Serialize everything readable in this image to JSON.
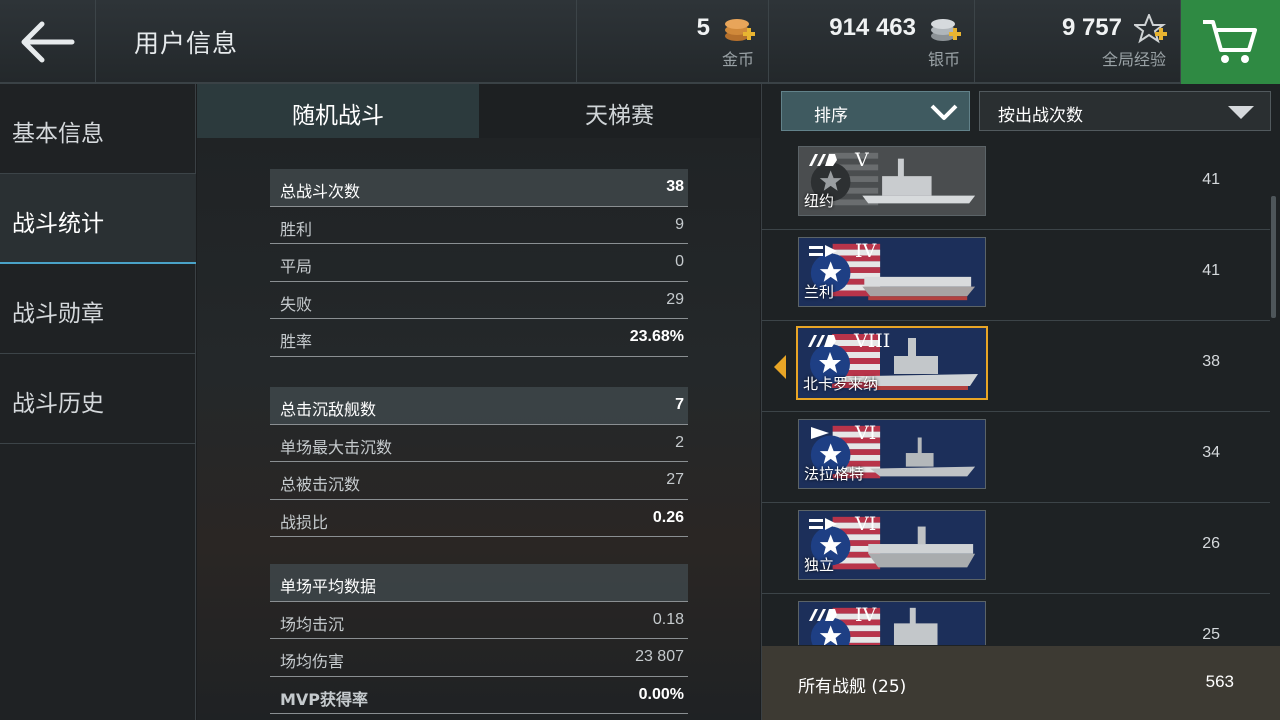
{
  "header": {
    "title": "用户信息",
    "currencies": [
      {
        "value": "5",
        "label": "金币",
        "icon": "gold-coins-icon"
      },
      {
        "value": "914 463",
        "label": "银币",
        "icon": "silver-coins-icon"
      },
      {
        "value": "9 757",
        "label": "全局经验",
        "icon": "star-xp-icon"
      }
    ]
  },
  "sidebar": {
    "items": [
      {
        "label": "基本信息",
        "active": false
      },
      {
        "label": "战斗统计",
        "active": true
      },
      {
        "label": "战斗勋章",
        "active": false
      },
      {
        "label": "战斗历史",
        "active": false
      }
    ]
  },
  "tabs": [
    {
      "label": "随机战斗",
      "active": true
    },
    {
      "label": "天梯赛",
      "active": false
    }
  ],
  "stats": {
    "group1": [
      {
        "k": "总战斗次数",
        "v": "38"
      },
      {
        "k": "胜利",
        "v": "9"
      },
      {
        "k": "平局",
        "v": "0"
      },
      {
        "k": "失败",
        "v": "29"
      },
      {
        "k": "胜率",
        "v": "23.68%"
      }
    ],
    "group2": [
      {
        "k": "总击沉敌舰数",
        "v": "7"
      },
      {
        "k": "单场最大击沉数",
        "v": "2"
      },
      {
        "k": "总被击沉数",
        "v": "27"
      },
      {
        "k": "战损比",
        "v": "0.26"
      }
    ],
    "group3": [
      {
        "k": "单场平均数据",
        "v": ""
      },
      {
        "k": "场均击沉",
        "v": "0.18"
      },
      {
        "k": "场均伤害",
        "v": "23 807"
      },
      {
        "k": "MVP获得率",
        "v": "0.00%"
      }
    ]
  },
  "sort": {
    "button_label": "排序",
    "select_value": "按出战次数"
  },
  "ships": [
    {
      "name": "纽约",
      "tier": "V",
      "count": "41"
    },
    {
      "name": "兰利",
      "tier": "IV",
      "count": "41"
    },
    {
      "name": "北卡罗来纳",
      "tier": "VIII",
      "count": "38"
    },
    {
      "name": "法拉格特",
      "tier": "VI",
      "count": "34"
    },
    {
      "name": "独立",
      "tier": "VI",
      "count": "26"
    },
    {
      "name": "",
      "tier": "IV",
      "count": "25"
    }
  ],
  "footer": {
    "label": "所有战舰 (25)",
    "total": "563"
  },
  "colors": {
    "accent_blue": "#4aa3c8",
    "cart_green": "#2f8a43",
    "selection_orange": "#e8a526"
  }
}
